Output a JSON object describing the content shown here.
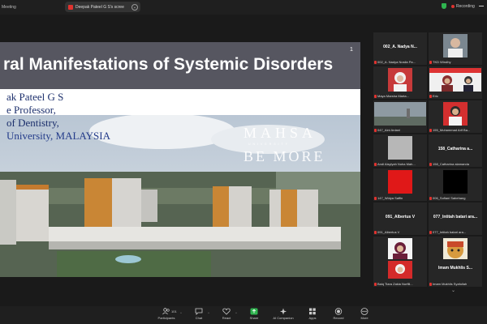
{
  "app": {
    "title": "Meeting"
  },
  "share": {
    "label": "Deepak Pateel G S's scree"
  },
  "recording": {
    "label": "Recording"
  },
  "slide": {
    "title": "ral Manifestations of Systemic Disorders",
    "page_number": "1",
    "presenter": "ak Pateel G S",
    "position": "e Professor,",
    "faculty": "of Dentistry,",
    "university": "University, MALAYSIA",
    "logo_main": "MAHSA",
    "logo_sub": "UNIVERSITY",
    "logo_tag": "BE MORE"
  },
  "gallery": {
    "tiles": [
      {
        "name": "002_A. Nadya N...",
        "caption": "002_A. Nadya Nosila Pa..."
      },
      {
        "name": "",
        "caption": "TKD Windhy"
      },
      {
        "name": "",
        "caption": "Maya Marsha Marta..."
      },
      {
        "name": "",
        "caption": "Eric"
      },
      {
        "name": "",
        "caption": "047_Aini Ardani"
      },
      {
        "name": "",
        "caption": "155_Muhammad Arif Ba..."
      },
      {
        "name": "",
        "caption": "Andi Aisyiyah Nuha Mah..."
      },
      {
        "name": "158_Catharina a...",
        "caption": "158_Catharina alamanda"
      },
      {
        "name": "",
        "caption": "147_Widya Saffin"
      },
      {
        "name": "",
        "caption": "006_Sofiani Sabehang"
      },
      {
        "name": "091_Albertus V",
        "caption": "091_Albertus V"
      },
      {
        "name": "077_Intitah batari ara...",
        "caption": "077_Intitah batari ara..."
      },
      {
        "name": "",
        "caption": "106_Aulia Syaghdia..."
      },
      {
        "name": "",
        "caption": "Alissa D. Ikawati"
      },
      {
        "name": "",
        "caption": "Baiq Tiara Zakia Nurfili..."
      },
      {
        "name": "Imam Mukhlis S...",
        "caption": "Imam Mukhlis Syafullah"
      }
    ]
  },
  "toolbar": {
    "participants": {
      "label": "Participants",
      "count": "101"
    },
    "chat": {
      "label": "Chat"
    },
    "react": {
      "label": "React"
    },
    "share": {
      "label": "Share"
    },
    "ai_companion": {
      "label": "AI Companion"
    },
    "apps": {
      "label": "Apps"
    },
    "record": {
      "label": "Record"
    },
    "more": {
      "label": "More"
    }
  },
  "colors": {
    "share_accent": "#2fb44f",
    "record_red": "#e0332f",
    "slide_title_bar": "#565660",
    "slide_text": "#1c2f6c"
  },
  "icons": [
    "shield-icon",
    "record-icon",
    "people-icon",
    "chat-icon",
    "heart-icon",
    "share-arrow-icon",
    "sparkle-icon",
    "apps-grid-icon",
    "record-button-icon",
    "more-dots-icon",
    "mic-muted-icon",
    "chevron-down-icon"
  ]
}
